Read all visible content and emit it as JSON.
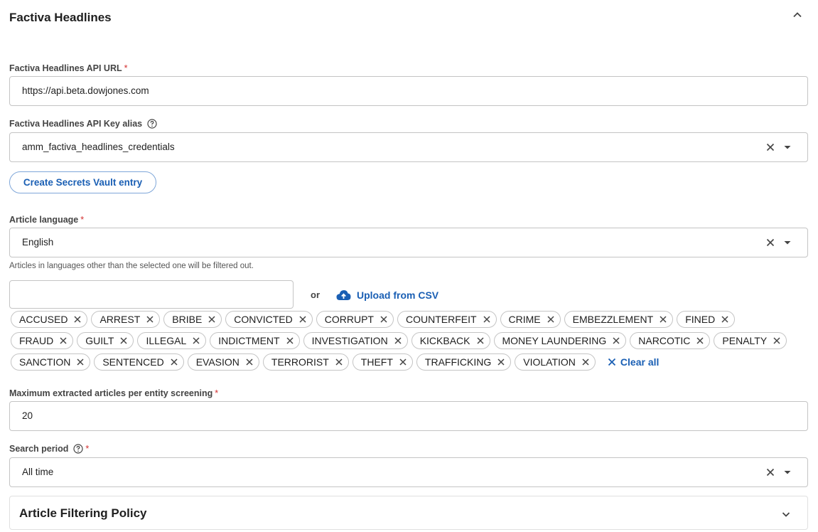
{
  "section": {
    "title": "Factiva Headlines",
    "icon": "chevron-up-icon"
  },
  "api_url": {
    "label": "Factiva Headlines API URL",
    "required": "*",
    "value": "https://api.beta.dowjones.com"
  },
  "api_key": {
    "label": "Factiva Headlines API Key alias",
    "value": "amm_factiva_headlines_credentials"
  },
  "secrets_button": {
    "label": "Create Secrets Vault entry"
  },
  "language": {
    "label": "Article language",
    "required": "*",
    "value": "English",
    "helper": "Articles in languages other than the selected one will be filtered out."
  },
  "keywords": {
    "input_value": "",
    "or_label": "or",
    "upload_label": "Upload from CSV",
    "clear_all_label": "Clear all",
    "rows": [
      [
        "ACCUSED",
        "ARREST",
        "BRIBE",
        "CONVICTED",
        "CORRUPT",
        "COUNTERFEIT",
        "CRIME",
        "EMBEZZLEMENT",
        "FINED"
      ],
      [
        "FRAUD",
        "GUILT",
        "ILLEGAL",
        "INDICTMENT",
        "INVESTIGATION",
        "KICKBACK",
        "MONEY LAUNDERING",
        "NARCOTIC",
        "PENALTY"
      ],
      [
        "SANCTION",
        "SENTENCED",
        "EVASION",
        "TERRORIST",
        "THEFT",
        "TRAFFICKING",
        "VIOLATION"
      ]
    ]
  },
  "max_articles": {
    "label": "Maximum extracted articles per entity screening",
    "required": "*",
    "value": "20"
  },
  "search_period": {
    "label": "Search period",
    "required": "*",
    "value": "All time"
  },
  "filtering_policy": {
    "title": "Article Filtering Policy",
    "icon": "chevron-down-icon"
  },
  "colors": {
    "accent": "#1a5fb4",
    "required": "#d32f2f",
    "border": "#c4c4c4"
  }
}
